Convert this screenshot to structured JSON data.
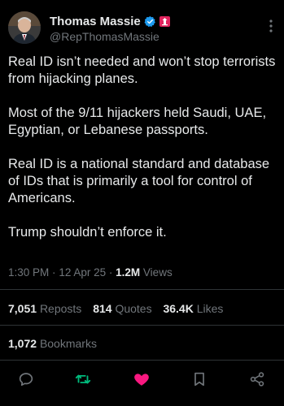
{
  "author": {
    "display_name": "Thomas Massie",
    "handle": "@RepThomasMassie",
    "avatar_icon": "avatar-photo",
    "verified_icon": "verified-badge-icon",
    "affiliation_icon": "government-affiliation-icon"
  },
  "tweet": {
    "paragraphs": [
      "Real ID isn’t needed and won’t stop terrorists from hijacking planes.",
      "Most of the 9/11 hijackers held Saudi, UAE, Egyptian, or Lebanese passports.",
      "Real ID is a national standard and database of IDs that is primarily a tool for control of Americans.",
      "Trump shouldn’t enforce it."
    ]
  },
  "meta": {
    "time": "1:30 PM",
    "date": "12 Apr 25",
    "separator": "·",
    "views_count": "1.2M",
    "views_label": "Views"
  },
  "stats": {
    "reposts_count": "7,051",
    "reposts_label": "Reposts",
    "quotes_count": "814",
    "quotes_label": "Quotes",
    "likes_count": "36.4K",
    "likes_label": "Likes",
    "bookmarks_count": "1,072",
    "bookmarks_label": "Bookmarks"
  },
  "actions": {
    "reply_icon": "reply-icon",
    "repost_icon": "repost-icon",
    "like_icon": "like-heart-icon",
    "bookmark_icon": "bookmark-icon",
    "share_icon": "share-icon"
  },
  "colors": {
    "background": "#000000",
    "text": "#e7e9ea",
    "secondary_text": "#71767b",
    "verified_blue": "#1d9bf0",
    "repost_green": "#00ba7c",
    "like_pink": "#f91880",
    "gov_badge_red": "#e0245e",
    "divider": "#2f3336"
  }
}
